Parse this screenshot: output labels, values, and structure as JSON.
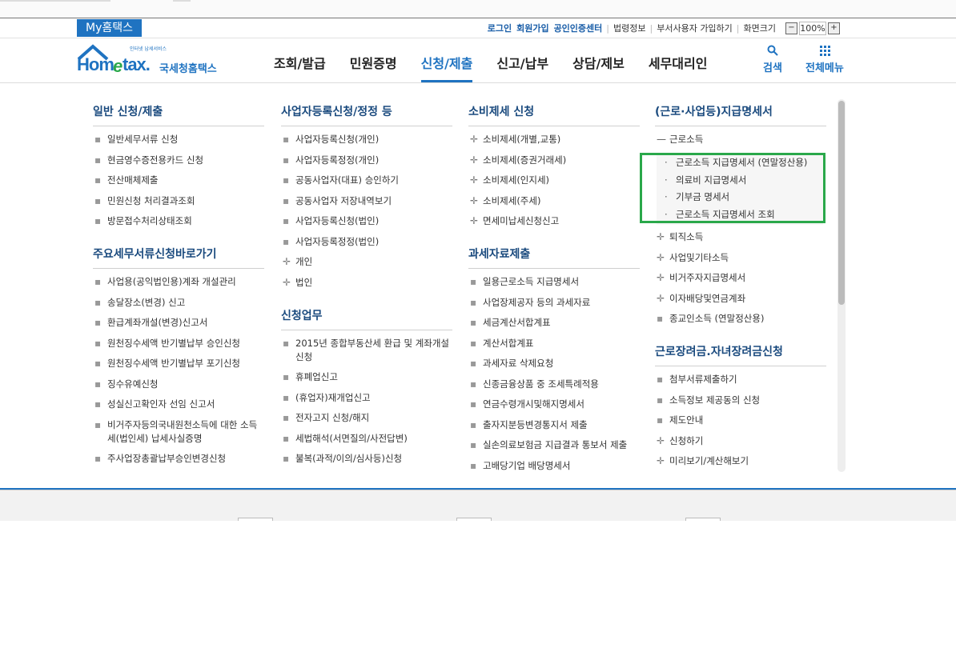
{
  "utility": {
    "my_tab": "My홈택스",
    "links": [
      "로그인",
      "회원가입",
      "공인인증센터",
      "법령정보",
      "부서사용자 가입하기",
      "화면크기"
    ],
    "zoom_minus": "−",
    "zoom_value": "100%",
    "zoom_plus": "+"
  },
  "header": {
    "logo_small": "인터넷 납세서비스",
    "logo_home": "Hom",
    "logo_e": "e",
    "logo_tax": "tax.",
    "logo_kr": "국세청홈택스",
    "nav": [
      "조회/발급",
      "민원증명",
      "신청/제출",
      "신고/납부",
      "상담/제보",
      "세무대리인"
    ],
    "search_label": "검색",
    "allmenu_label": "전체메뉴"
  },
  "menu": {
    "col1": {
      "s1_title": "일반 신청/제출",
      "s1_items": [
        "일반세무서류 신청",
        "현금영수증전용카드 신청",
        "전산매체제출",
        "민원신청 처리결과조회",
        "방문접수처리상태조회"
      ],
      "s2_title": "주요세무서류신청바로가기",
      "s2_items": [
        "사업용(공익법인용)계좌 개설관리",
        "송달장소(변경) 신고",
        "환급계좌개설(변경)신고서",
        "원천징수세액 반기별납부 승인신청",
        "원천징수세액 반기별납부 포기신청",
        "징수유예신청",
        "성실신고확인자 선임 신고서",
        "비거주자등의국내원천소득에 대한 소득세(법인세) 납세사실증명",
        "주사업장총괄납부승인변경신청"
      ]
    },
    "col2": {
      "s1_title": "사업자등록신청/정정 등",
      "s1_items": [
        "사업자등록신청(개인)",
        "사업자등록정정(개인)",
        "공동사업자(대표) 승인하기",
        "공동사업자 저장내역보기",
        "사업자등록신청(법인)",
        "사업자등록정정(법인)"
      ],
      "s1_plus": [
        "개인",
        "법인"
      ],
      "s2_title": "신청업무",
      "s2_items": [
        "2015년 종합부동산세 환급 및 계좌개설 신청",
        "휴폐업신고",
        "(휴업자)재개업신고",
        "전자고지 신청/해지",
        "세법해석(서면질의/사전답변)",
        "불복(과적/이의/심사등)신청"
      ]
    },
    "col3": {
      "s1_title": "소비제세 신청",
      "s1_items": [
        "소비제세(개별,교통)",
        "소비제세(증권거래세)",
        "소비제세(인지세)",
        "소비제세(주세)",
        "면세미납세신청신고"
      ],
      "s2_title": "과세자료제출",
      "s2_items": [
        "일용근로소득 지급명세서",
        "사업장제공자 등의 과세자료",
        "세금계산서합계표",
        "계산서합계표",
        "과세자료 삭제요청",
        "신종금융상품 중 조세특례적용",
        "연금수령개시및해지명세서",
        "출자지분등변경통지서 제출",
        "실손의료보험금 지급결과 통보서 제출",
        "고배당기업 배당명세서"
      ]
    },
    "col4": {
      "s1_title": "(근로·사업등)지급명세서",
      "expanded": "근로소득",
      "sub_items": [
        "근로소득 지급명세서 (연말정산용)",
        "의료비 지급명세서",
        "기부금 명세서",
        "근로소득 지급명세서 조회"
      ],
      "plus_items": [
        "퇴직소득",
        "사업및기타소득",
        "비거주자지급명세서",
        "이자배당및연금계좌"
      ],
      "last_item": "종교인소득 (연말정산용)",
      "s2_title": "근로장려금.자녀장려금신청",
      "s2_items": [
        "첨부서류제출하기",
        "소득정보 제공동의 신청",
        "제도안내"
      ],
      "s2_plus": [
        "신청하기",
        "미리보기/계산해보기"
      ]
    }
  },
  "colors": {
    "brand": "#1f73c1",
    "highlight": "#2aa84a"
  }
}
